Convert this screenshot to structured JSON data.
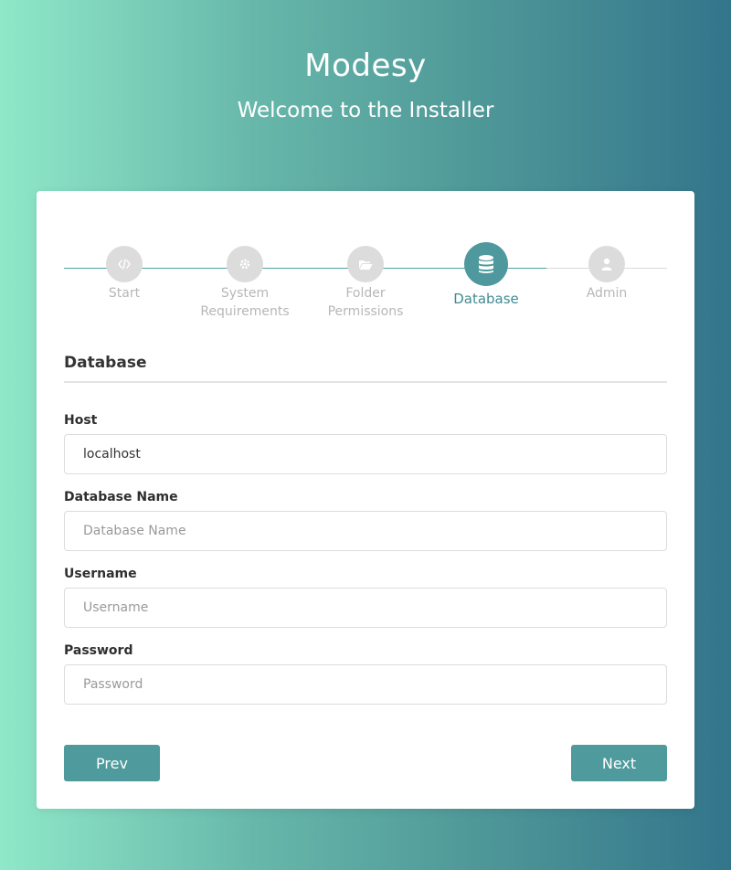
{
  "header": {
    "title": "Modesy",
    "subtitle": "Welcome to the Installer"
  },
  "steps": [
    {
      "label": "Start",
      "icon": "code-icon",
      "state": "done"
    },
    {
      "label": "System\nRequirements",
      "icon": "gear-icon",
      "state": "done"
    },
    {
      "label": "Folder\nPermissions",
      "icon": "folder-open-icon",
      "state": "done"
    },
    {
      "label": "Database",
      "icon": "database-icon",
      "state": "active"
    },
    {
      "label": "Admin",
      "icon": "user-icon",
      "state": "pending"
    }
  ],
  "form": {
    "section_title": "Database",
    "host": {
      "label": "Host",
      "value": "localhost",
      "placeholder": ""
    },
    "db_name": {
      "label": "Database Name",
      "value": "",
      "placeholder": "Database Name"
    },
    "username": {
      "label": "Username",
      "value": "",
      "placeholder": "Username"
    },
    "password": {
      "label": "Password",
      "value": "",
      "placeholder": "Password"
    }
  },
  "buttons": {
    "prev": "Prev",
    "next": "Next"
  },
  "colors": {
    "accent": "#4f999e",
    "inactive_step": "#dcdcdc",
    "gradient_start": "#8fe8c8",
    "gradient_end": "#33758c"
  }
}
